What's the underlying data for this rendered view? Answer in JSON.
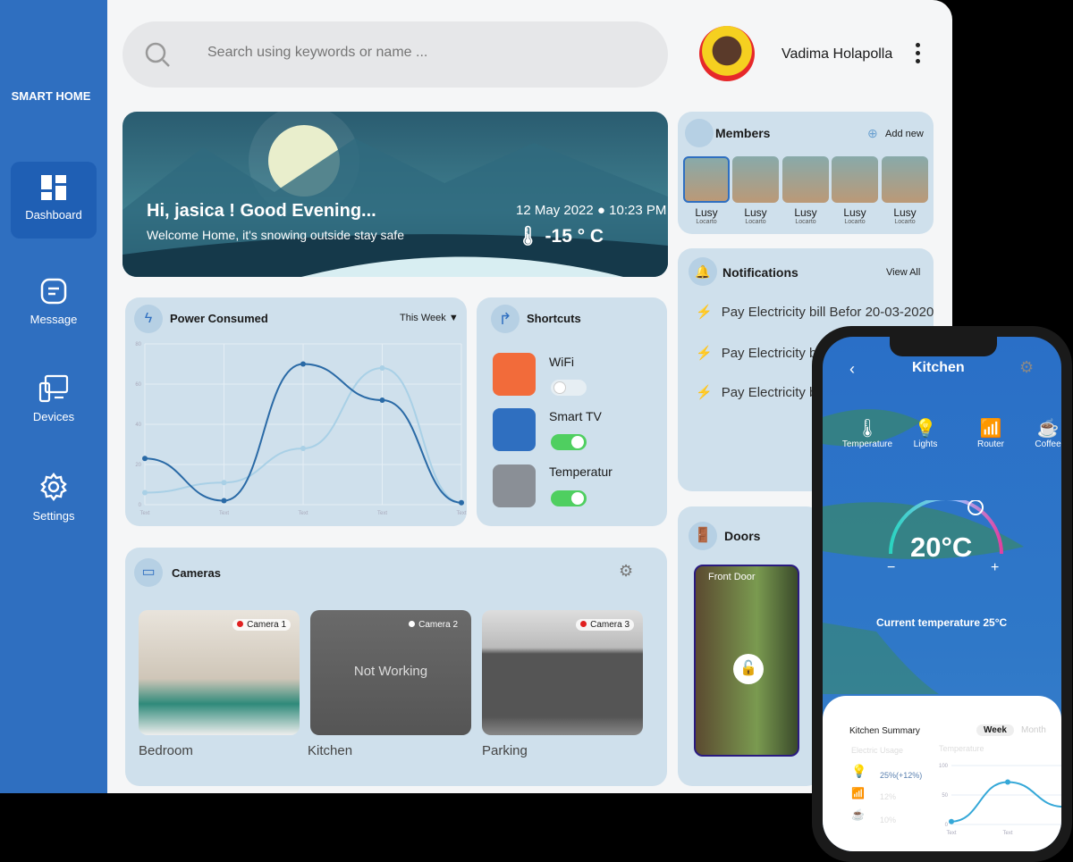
{
  "app": {
    "brand": "SMART HOME"
  },
  "sidebar": {
    "items": [
      {
        "label": "Dashboard",
        "icon": "dashboard-icon",
        "active": true
      },
      {
        "label": "Message",
        "icon": "message-icon"
      },
      {
        "label": "Devices",
        "icon": "devices-icon"
      },
      {
        "label": "Settings",
        "icon": "gear-icon"
      }
    ]
  },
  "search": {
    "placeholder": "Search using keywords or name ..."
  },
  "user": {
    "name": "Vadima Holapolla"
  },
  "hero": {
    "greeting": "Hi, jasica ! Good Evening...",
    "subtitle": "Welcome Home, it's snowing outside stay safe",
    "date": "12 May 2022",
    "time": "10:23 PM",
    "temperature": "-15 ° C"
  },
  "members": {
    "title": "Members",
    "add_label": "Add new",
    "items": [
      {
        "name": "Lusy",
        "sub": "Locarto"
      },
      {
        "name": "Lusy",
        "sub": "Locarto"
      },
      {
        "name": "Lusy",
        "sub": "Locarto"
      },
      {
        "name": "Lusy",
        "sub": "Locarto"
      },
      {
        "name": "Lusy",
        "sub": "Locarto"
      }
    ]
  },
  "notifications": {
    "title": "Notifications",
    "view_all": "View All",
    "items": [
      "Pay Electricity bill Befor 20-03-2020",
      "Pay Electricity bill",
      "Pay Electricity bi"
    ]
  },
  "power": {
    "title": "Power Consumed",
    "range": "This Week"
  },
  "shortcuts": {
    "title": "Shortcuts",
    "items": [
      {
        "label": "WiFi",
        "on": false,
        "color": "#f26b3a"
      },
      {
        "label": "Smart TV",
        "on": true,
        "color": "#2f6fc0"
      },
      {
        "label": "Temperatur",
        "on": true,
        "color": "#8a8f96"
      }
    ]
  },
  "doors": {
    "title": "Doors",
    "front": "Front Door"
  },
  "cameras": {
    "title": "Cameras",
    "items": [
      {
        "label": "Camera 1",
        "room": "Bedroom",
        "status": "#e02020",
        "overlay": ""
      },
      {
        "label": "Camera 2",
        "room": "Kitchen",
        "status": "#ffffff",
        "overlay": "Not Working"
      },
      {
        "label": "Camera 3",
        "room": "Parking",
        "status": "#e02020",
        "overlay": ""
      }
    ]
  },
  "phone": {
    "title": "Kitchen",
    "devices": [
      "Temperature",
      "Lights",
      "Router",
      "Coffee"
    ],
    "set_temp": "20°C",
    "minus": "−",
    "plus": "+",
    "current": "Current temperature 25°C",
    "summary": {
      "title": "Kitchen Summary",
      "tabs": [
        "Week",
        "Month"
      ],
      "electric_label": "Electric Usage",
      "temp_label": "Temperature",
      "usage": [
        "25%(+12%)",
        "12%",
        "10%"
      ]
    }
  },
  "colors": {
    "sidebar": "#2f6fc0",
    "card": "#cfe0ec",
    "series_dark": "#2a6aa6",
    "series_light": "#a9d0e6"
  },
  "chart_data": [
    {
      "type": "line",
      "title": "Power Consumed",
      "categories": [
        "Text",
        "Text",
        "Text",
        "Text",
        "Text"
      ],
      "ylim": [
        0,
        80
      ],
      "yticks": [
        0,
        20,
        40,
        60,
        80
      ],
      "grid": true,
      "series": [
        {
          "values": [
            23,
            2,
            70,
            52,
            1
          ]
        },
        {
          "values": [
            6,
            11,
            28,
            68,
            1
          ]
        }
      ]
    },
    {
      "type": "line",
      "title": "Temperature",
      "categories": [
        "Text",
        "Text",
        "Text"
      ],
      "ylim": [
        0,
        100
      ],
      "yticks": [
        0,
        50,
        100
      ],
      "series": [
        {
          "values": [
            5,
            72,
            30
          ]
        }
      ]
    }
  ]
}
